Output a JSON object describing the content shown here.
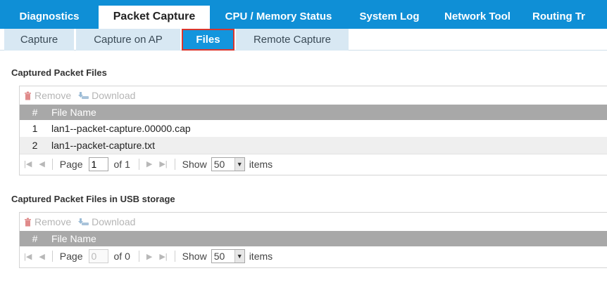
{
  "top_tabs": [
    {
      "label": "Diagnostics",
      "active": false
    },
    {
      "label": "Packet Capture",
      "active": true
    },
    {
      "label": "CPU / Memory Status",
      "active": false
    },
    {
      "label": "System Log",
      "active": false
    },
    {
      "label": "Network Tool",
      "active": false
    },
    {
      "label": "Routing Tr",
      "active": false
    }
  ],
  "sub_tabs": [
    {
      "label": "Capture",
      "active": false
    },
    {
      "label": "Capture on AP",
      "active": false
    },
    {
      "label": "Files",
      "active": true
    },
    {
      "label": "Remote Capture",
      "active": false
    }
  ],
  "section1": {
    "title": "Captured Packet Files",
    "toolbar": {
      "remove": "Remove",
      "download": "Download"
    },
    "columns": {
      "num": "#",
      "name": "File Name"
    },
    "rows": [
      {
        "num": "1",
        "name": "lan1--packet-capture.00000.cap"
      },
      {
        "num": "2",
        "name": "lan1--packet-capture.txt"
      }
    ],
    "pager": {
      "page_label": "Page",
      "page_value": "1",
      "of_label": "of 1",
      "show_label": "Show",
      "items_value": "50",
      "items_label": "items"
    }
  },
  "section2": {
    "title": "Captured Packet Files in USB storage",
    "toolbar": {
      "remove": "Remove",
      "download": "Download"
    },
    "columns": {
      "num": "#",
      "name": "File Name"
    },
    "pager": {
      "page_label": "Page",
      "page_value": "0",
      "of_label": "of 0",
      "show_label": "Show",
      "items_value": "50",
      "items_label": "items"
    }
  },
  "colors": {
    "accent": "#0f8fd6",
    "active_subtab": "#1395dd",
    "highlight": "#d9372f",
    "grid_header": "#a8a8a8"
  }
}
